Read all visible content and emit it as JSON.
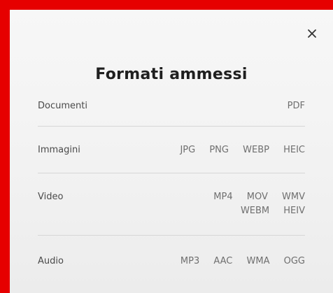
{
  "modal": {
    "title": "Formati ammessi",
    "close_icon": "close-icon"
  },
  "formats": [
    {
      "label": "Documenti",
      "values": [
        [
          "PDF"
        ]
      ]
    },
    {
      "label": "Immagini",
      "values": [
        [
          "JPG",
          "PNG",
          "WEBP",
          "HEIC"
        ]
      ]
    },
    {
      "label": "Video",
      "values": [
        [
          "MP4",
          "MOV",
          "WMV"
        ],
        [
          "WEBM",
          "HEIV"
        ]
      ]
    },
    {
      "label": "Audio",
      "values": [
        [
          "MP3",
          "AAC",
          "WMA",
          "OGG"
        ]
      ]
    }
  ],
  "colors": {
    "border": "#e60000",
    "background": "#f4f4f4",
    "title": "#1f1f1f",
    "text": "#6f6f6f",
    "divider": "#d6d6d6"
  }
}
